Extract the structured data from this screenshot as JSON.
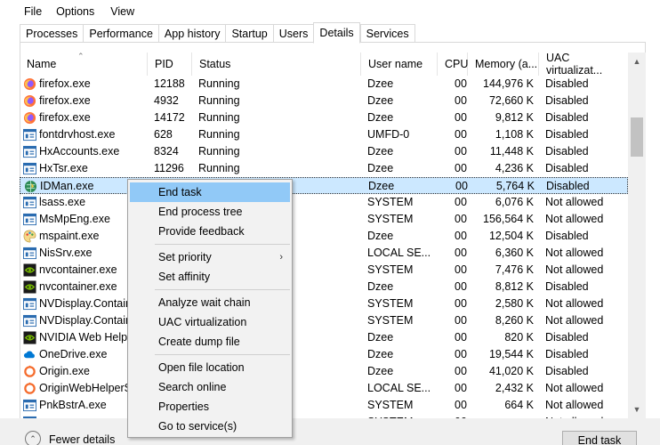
{
  "menu": [
    "File",
    "Options",
    "View"
  ],
  "tabs": [
    "Processes",
    "Performance",
    "App history",
    "Startup",
    "Users",
    "Details",
    "Services"
  ],
  "active_tab": "Details",
  "columns": [
    "Name",
    "PID",
    "Status",
    "User name",
    "CPU",
    "Memory (a...",
    "UAC virtualizat..."
  ],
  "rows": [
    {
      "name": "firefox.exe",
      "pid": "12188",
      "status": "Running",
      "user": "Dzee",
      "cpu": "00",
      "mem": "144,976 K",
      "uac": "Disabled",
      "icon": "firefox-icon"
    },
    {
      "name": "firefox.exe",
      "pid": "4932",
      "status": "Running",
      "user": "Dzee",
      "cpu": "00",
      "mem": "72,660 K",
      "uac": "Disabled",
      "icon": "firefox-icon"
    },
    {
      "name": "firefox.exe",
      "pid": "14172",
      "status": "Running",
      "user": "Dzee",
      "cpu": "00",
      "mem": "9,812 K",
      "uac": "Disabled",
      "icon": "firefox-icon"
    },
    {
      "name": "fontdrvhost.exe",
      "pid": "628",
      "status": "Running",
      "user": "UMFD-0",
      "cpu": "00",
      "mem": "1,108 K",
      "uac": "Disabled",
      "icon": "window-app-icon"
    },
    {
      "name": "HxAccounts.exe",
      "pid": "8324",
      "status": "Running",
      "user": "Dzee",
      "cpu": "00",
      "mem": "11,448 K",
      "uac": "Disabled",
      "icon": "window-app-icon"
    },
    {
      "name": "HxTsr.exe",
      "pid": "11296",
      "status": "Running",
      "user": "Dzee",
      "cpu": "00",
      "mem": "4,236 K",
      "uac": "Disabled",
      "icon": "window-app-icon"
    },
    {
      "name": "IDMan.exe",
      "pid": "",
      "status": "",
      "user": "Dzee",
      "cpu": "00",
      "mem": "5,764 K",
      "uac": "Disabled",
      "icon": "idm-globe-icon"
    },
    {
      "name": "lsass.exe",
      "pid": "",
      "status": "",
      "user": "SYSTEM",
      "cpu": "00",
      "mem": "6,076 K",
      "uac": "Not allowed",
      "icon": "window-app-icon"
    },
    {
      "name": "MsMpEng.exe",
      "pid": "",
      "status": "",
      "user": "SYSTEM",
      "cpu": "00",
      "mem": "156,564 K",
      "uac": "Not allowed",
      "icon": "window-app-icon"
    },
    {
      "name": "mspaint.exe",
      "pid": "",
      "status": "",
      "user": "Dzee",
      "cpu": "00",
      "mem": "12,504 K",
      "uac": "Disabled",
      "icon": "paint-icon"
    },
    {
      "name": "NisSrv.exe",
      "pid": "",
      "status": "",
      "user": "LOCAL SE...",
      "cpu": "00",
      "mem": "6,360 K",
      "uac": "Not allowed",
      "icon": "window-app-icon"
    },
    {
      "name": "nvcontainer.exe",
      "pid": "",
      "status": "",
      "user": "SYSTEM",
      "cpu": "00",
      "mem": "7,476 K",
      "uac": "Not allowed",
      "icon": "nvidia-icon"
    },
    {
      "name": "nvcontainer.exe",
      "pid": "",
      "status": "",
      "user": "Dzee",
      "cpu": "00",
      "mem": "8,812 K",
      "uac": "Disabled",
      "icon": "nvidia-icon"
    },
    {
      "name": "NVDisplay.Contain",
      "pid": "",
      "status": "",
      "user": "SYSTEM",
      "cpu": "00",
      "mem": "2,580 K",
      "uac": "Not allowed",
      "icon": "window-app-icon"
    },
    {
      "name": "NVDisplay.Contain",
      "pid": "",
      "status": "",
      "user": "SYSTEM",
      "cpu": "00",
      "mem": "8,260 K",
      "uac": "Not allowed",
      "icon": "window-app-icon"
    },
    {
      "name": "NVIDIA Web Helpe",
      "pid": "",
      "status": "",
      "user": "Dzee",
      "cpu": "00",
      "mem": "820 K",
      "uac": "Disabled",
      "icon": "nvidia-icon"
    },
    {
      "name": "OneDrive.exe",
      "pid": "",
      "status": "",
      "user": "Dzee",
      "cpu": "00",
      "mem": "19,544 K",
      "uac": "Disabled",
      "icon": "onedrive-icon"
    },
    {
      "name": "Origin.exe",
      "pid": "",
      "status": "",
      "user": "Dzee",
      "cpu": "00",
      "mem": "41,020 K",
      "uac": "Disabled",
      "icon": "origin-icon"
    },
    {
      "name": "OriginWebHelperS",
      "pid": "",
      "status": "",
      "user": "LOCAL SE...",
      "cpu": "00",
      "mem": "2,432 K",
      "uac": "Not allowed",
      "icon": "origin-icon"
    },
    {
      "name": "PnkBstrA.exe",
      "pid": "",
      "status": "",
      "user": "SYSTEM",
      "cpu": "00",
      "mem": "664 K",
      "uac": "Not allowed",
      "icon": "window-app-icon"
    },
    {
      "name": "",
      "pid": "",
      "status": "",
      "user": "SYSTEM",
      "cpu": "00",
      "mem": "",
      "uac": "Not allowed",
      "icon": "window-app-icon"
    }
  ],
  "selected_row": "IDMan.exe",
  "context_menu": {
    "items": [
      "End task",
      "End process tree",
      "Provide feedback",
      "Set priority",
      "Set affinity",
      "Analyze wait chain",
      "UAC virtualization",
      "Create dump file",
      "Open file location",
      "Search online",
      "Properties",
      "Go to service(s)"
    ],
    "highlighted": "End task"
  },
  "footer": {
    "fewer_details": "Fewer details",
    "end_task": "End task"
  },
  "colors": {
    "selection": "#cce8ff",
    "menu_highlight": "#91c9f7",
    "firefox": "#ff7139",
    "nvidia": "#76b900",
    "onedrive": "#0078d4",
    "origin": "#f56c2d"
  }
}
